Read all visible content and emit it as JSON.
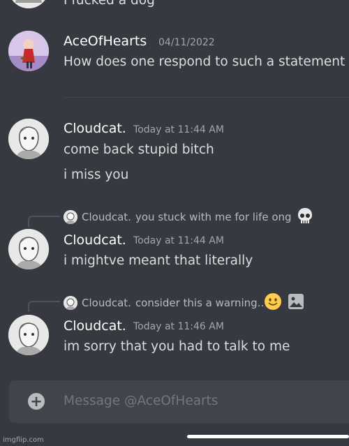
{
  "messages": {
    "partial_text": "I fucked a dog",
    "ace": {
      "name": "AceOfHearts",
      "time": "04/11/2022",
      "text": "How does one respond to such a statement"
    },
    "cloud1": {
      "name": "Cloudcat.",
      "time": "Today at 11:44 AM",
      "line1": "come back stupid bitch",
      "line2": "i miss you"
    },
    "reply1": {
      "ref_name": "Cloudcat.",
      "ref_text": "you stuck with me for life ong",
      "emoji": "skull"
    },
    "cloud2": {
      "name": "Cloudcat.",
      "time": "Today at 11:44 AM",
      "text": "i mightve meant that literally"
    },
    "reply2": {
      "ref_name": "Cloudcat.",
      "ref_text": "consider this a warning..",
      "emoji": "slightly-smiling-face",
      "attachment_icon": "image-icon"
    },
    "cloud3": {
      "name": "Cloudcat.",
      "time": "Today at 11:46 AM",
      "text": "im sorry that you had to talk to me"
    }
  },
  "composer": {
    "placeholder": "Message @AceOfHearts",
    "add_icon": "plus-icon"
  },
  "watermark": "imgflip.com",
  "colors": {
    "background": "#36393f",
    "composer": "#40444b",
    "username": "#ffffff",
    "timestamp": "#a3a6aa"
  }
}
